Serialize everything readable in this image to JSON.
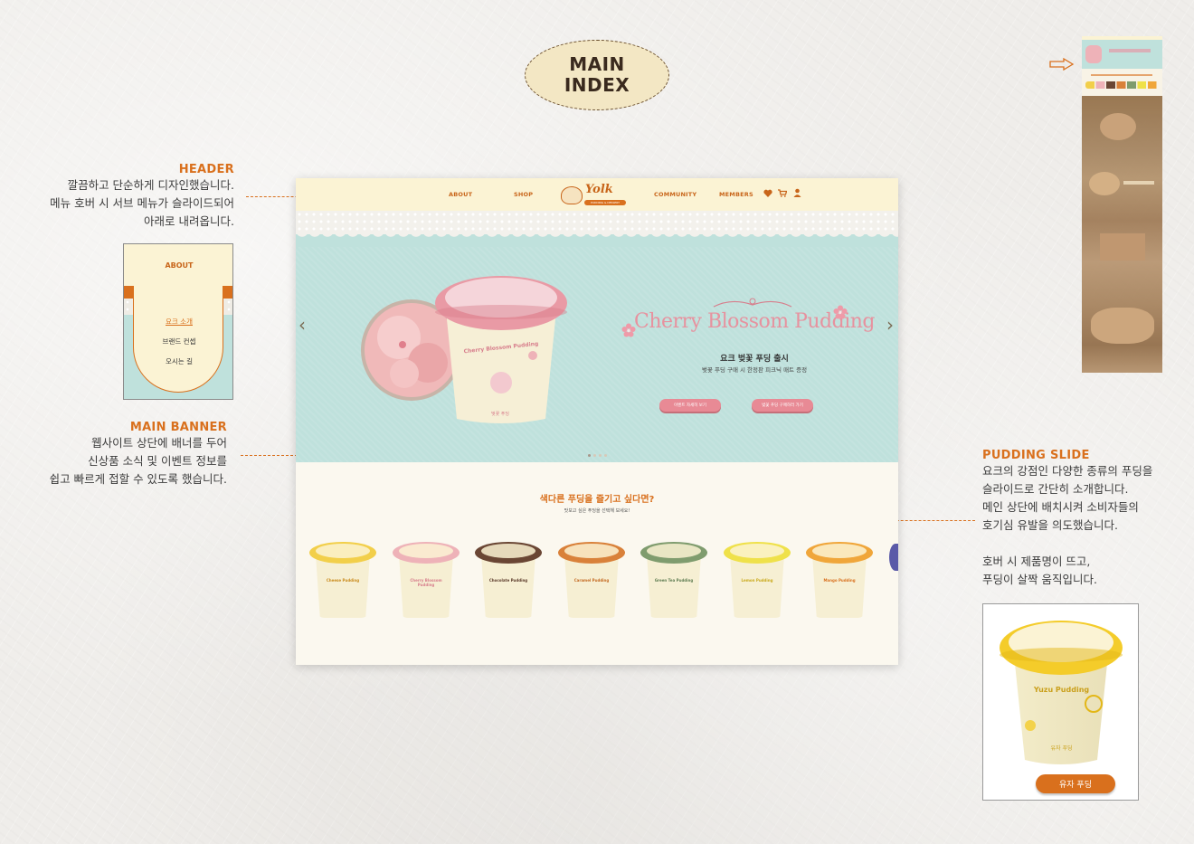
{
  "page_badge": {
    "line1": "MAIN",
    "line2": "INDEX"
  },
  "header_note": {
    "title": "HEADER",
    "lines": [
      "깔끔하고 단순하게 디자인했습니다.",
      "메뉴 호버 시 서브 메뉴가 슬라이드되어",
      "아래로 내려옵니다."
    ]
  },
  "submenu_preview": {
    "title": "ABOUT",
    "items": [
      "요크 소개",
      "브랜드 컨셉",
      "오시는 길"
    ]
  },
  "banner_note": {
    "title": "MAIN BANNER",
    "lines": [
      "웹사이트 상단에 배너를 두어",
      "신상품 소식 및 이벤트 정보를",
      "쉽고 빠르게 접할 수 있도록 했습니다."
    ]
  },
  "pudding_note": {
    "title": "PUDDING SLIDE",
    "lines": [
      "요크의 강점인 다양한 종류의 푸딩을",
      "슬라이드로 간단히 소개합니다.",
      "메인 상단에 배치시켜 소비자들의",
      "호기심 유발을 의도했습니다."
    ],
    "lines2": [
      "호버 시 제품명이 뜨고,",
      "푸딩이 살짝 움직입니다."
    ]
  },
  "site": {
    "nav": [
      "ABOUT",
      "SHOP",
      "COMMUNITY",
      "MEMBERS"
    ],
    "logo": "Yolk",
    "logo_tag": "PUDDING & DESSERT",
    "banner": {
      "title": "Cherry Blossom Pudding",
      "subtitle": "요크 벚꽃 푸딩 출시",
      "desc": "벚꽃 푸딩 구매 시 한정판 피크닉 매트 증정",
      "btn1": "이벤트 자세히 보기",
      "btn2": "벚꽃 푸딩 구매하러 가기",
      "cup_label": "Cherry Blossom Pudding",
      "cup_sub": "벚꽃 푸딩"
    },
    "section": {
      "title": "색다른 푸딩을 즐기고 싶다면?",
      "subtitle": "맛보고 싶은 푸딩을 선택해 보세요!"
    },
    "puddings": [
      {
        "name": "Cheese Pudding",
        "color": "#f2cf4a",
        "text": "#c98a1a"
      },
      {
        "name": "Cherry Blossom Pudding",
        "color": "#eeb2b8",
        "text": "#d77e8c"
      },
      {
        "name": "Chocolate Pudding",
        "color": "#6a4634",
        "text": "#5b3a2a"
      },
      {
        "name": "Caramel Pudding",
        "color": "#d9813a",
        "text": "#c46a22"
      },
      {
        "name": "Green Tea Pudding",
        "color": "#7f9c6e",
        "text": "#5f7d52"
      },
      {
        "name": "Lemon Pudding",
        "color": "#efe14a",
        "text": "#c9a91a"
      },
      {
        "name": "Mango Pudding",
        "color": "#f0a63a",
        "text": "#d9701d"
      }
    ]
  },
  "yuzu": {
    "name": "Yuzu Pudding",
    "button": "유자 푸딩",
    "sub": "유자 푸딩"
  }
}
